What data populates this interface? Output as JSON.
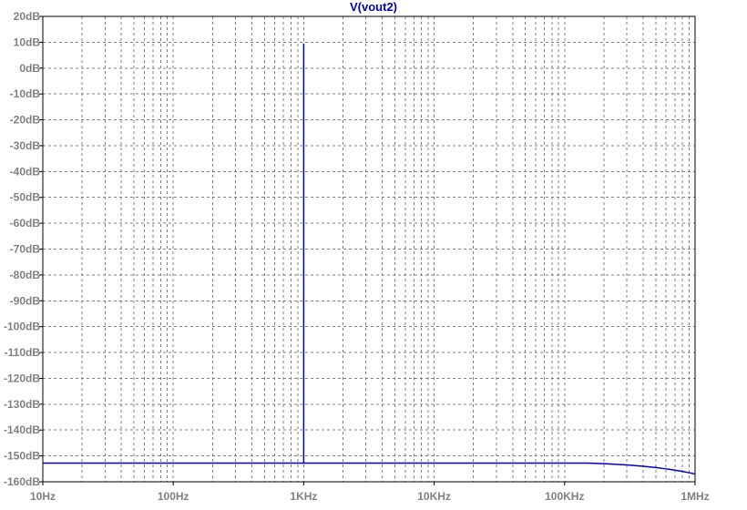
{
  "colors": {
    "background": "#ffffff",
    "frame": "#000000",
    "grid": "#7f7f7f",
    "trace": "#0000cc",
    "title": "#0000cc",
    "tick_label": "#808080"
  },
  "chart_data": {
    "type": "line",
    "title": "V(vout2)",
    "xscale": "log",
    "grid": true,
    "grid_style": "dashed",
    "xlim": [
      10,
      1000000
    ],
    "ylim": [
      -160,
      20
    ],
    "x_ticks": [
      10,
      100,
      1000,
      10000,
      100000,
      1000000
    ],
    "x_tick_labels": [
      "10Hz",
      "100Hz",
      "1KHz",
      "10KHz",
      "100KHz",
      "1MHz"
    ],
    "y_ticks": [
      20,
      10,
      0,
      -10,
      -20,
      -30,
      -40,
      -50,
      -60,
      -70,
      -80,
      -90,
      -100,
      -110,
      -120,
      -130,
      -140,
      -150,
      -160
    ],
    "y_tick_labels": [
      "20dB",
      "10dB",
      "0dB",
      "-10dB",
      "-20dB",
      "-30dB",
      "-40dB",
      "-50dB",
      "-60dB",
      "-70dB",
      "-80dB",
      "-90dB",
      "-100dB",
      "-110dB",
      "-120dB",
      "-130dB",
      "-140dB",
      "-150dB",
      "-160dB"
    ],
    "series": [
      {
        "x": [
          10,
          100,
          900,
          995,
          1000,
          1000,
          1000,
          1005,
          1100,
          10000,
          100000,
          150000,
          200000,
          300000,
          400000,
          500000,
          600000,
          700000,
          800000,
          900000,
          1000000
        ],
        "y": [
          -152.8,
          -152.8,
          -152.8,
          -152.8,
          -152.8,
          9.5,
          -152.8,
          -152.8,
          -152.8,
          -152.8,
          -152.8,
          -152.8,
          -153.0,
          -153.5,
          -154.0,
          -154.5,
          -155.0,
          -155.5,
          -156.0,
          -156.5,
          -157.0
        ]
      }
    ]
  }
}
